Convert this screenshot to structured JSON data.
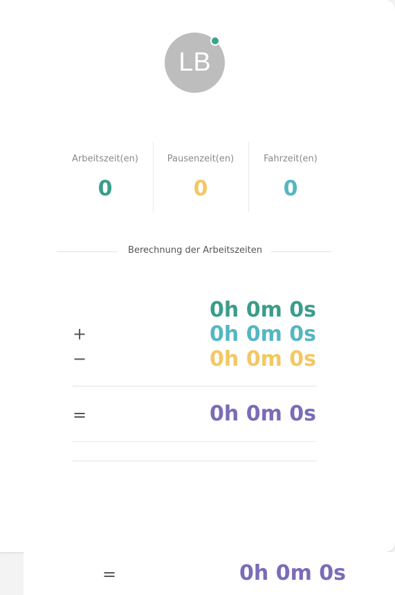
{
  "profile": {
    "initials": "LB",
    "status": "online"
  },
  "stats": [
    {
      "label": "Arbeitszeit(en)",
      "value": "0",
      "color": "#3a9d8b"
    },
    {
      "label": "Pausenzeit(en)",
      "value": "0",
      "color": "#f2c864"
    },
    {
      "label": "Fahrzeit(en)",
      "value": "0",
      "color": "#53b7c2"
    }
  ],
  "calculation": {
    "title": "Berechnung der Arbeitszeiten",
    "work": {
      "value": "0h 0m 0s",
      "color": "#3a9d8b"
    },
    "travel": {
      "operator": "+",
      "value": "0h 0m 0s",
      "color": "#53b7c2"
    },
    "break": {
      "operator": "−",
      "value": "0h 0m 0s",
      "color": "#f2c864"
    },
    "result": {
      "operator": "=",
      "value": "0h 0m 0s",
      "color": "#7b6bb8"
    }
  },
  "footer": {
    "operator": "=",
    "value": "0h 0m 0s",
    "color": "#7b6bb8"
  }
}
